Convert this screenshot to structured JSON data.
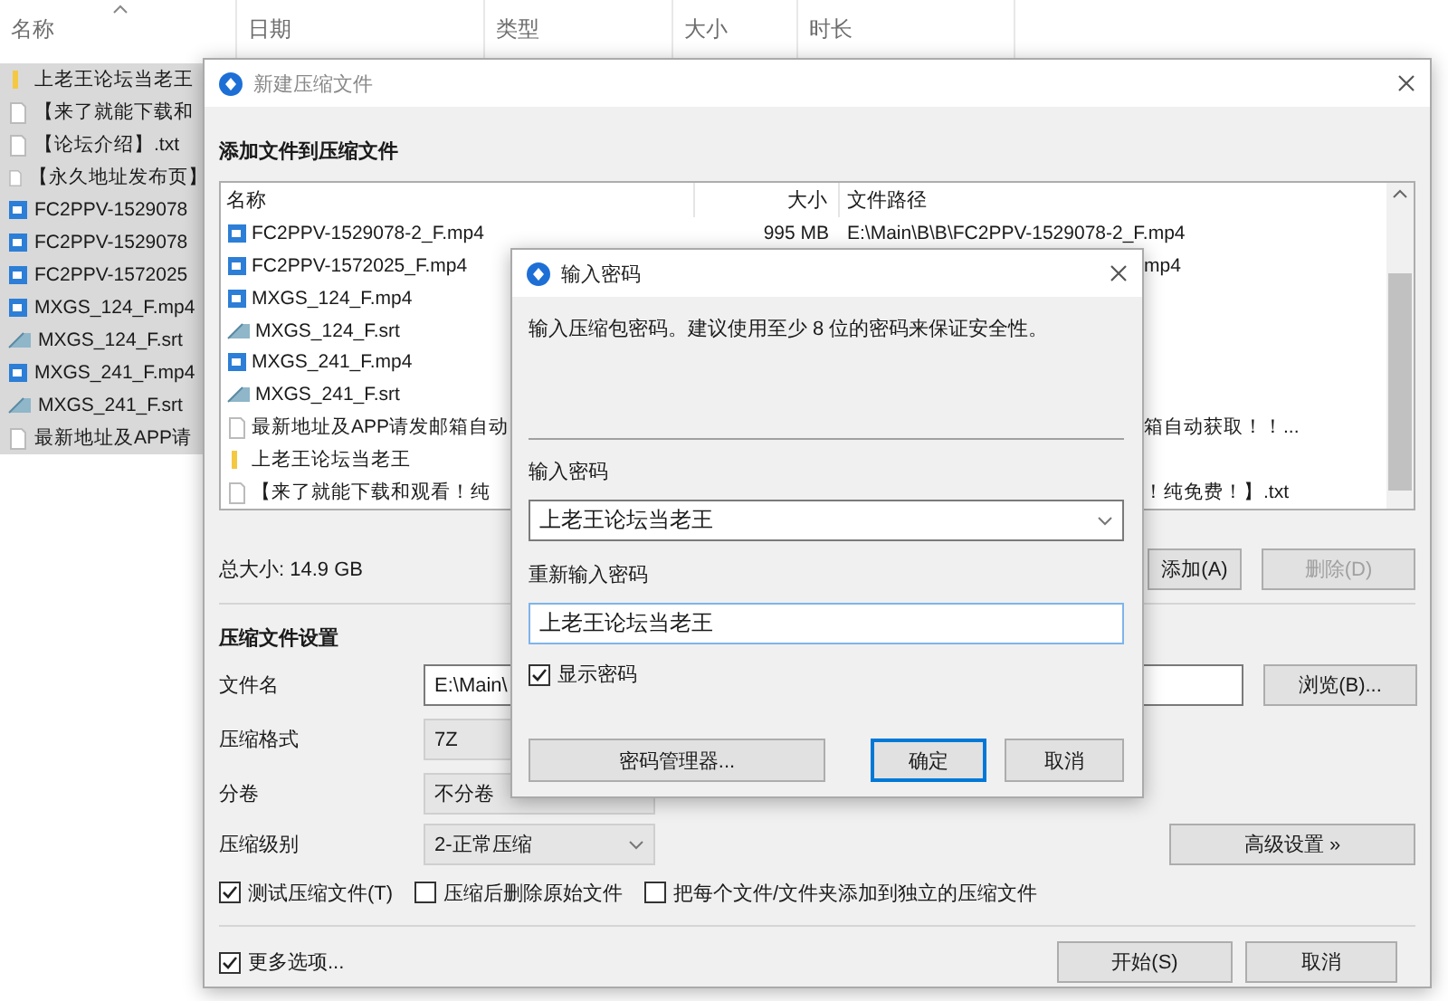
{
  "explorer": {
    "columns": [
      "名称",
      "日期",
      "类型",
      "大小",
      "时长"
    ],
    "items": [
      {
        "name": "上老王论坛当老王",
        "kind": "folder",
        "selected": true
      },
      {
        "name": "【来了就能下载和",
        "kind": "text",
        "selected": true
      },
      {
        "name": "【论坛介绍】.txt",
        "kind": "text",
        "selected": true
      },
      {
        "name": "【永久地址发布页】",
        "kind": "text",
        "selected": true
      },
      {
        "name": "FC2PPV-1529078",
        "kind": "video",
        "selected": true
      },
      {
        "name": "FC2PPV-1529078",
        "kind": "video",
        "selected": true
      },
      {
        "name": "FC2PPV-1572025",
        "kind": "video",
        "selected": true
      },
      {
        "name": "MXGS_124_F.mp4",
        "kind": "video",
        "selected": true
      },
      {
        "name": "MXGS_124_F.srt",
        "kind": "subtitle",
        "selected": true
      },
      {
        "name": "MXGS_241_F.mp4",
        "kind": "video",
        "selected": true
      },
      {
        "name": "MXGS_241_F.srt",
        "kind": "subtitle",
        "selected": true
      },
      {
        "name": "最新地址及APP请",
        "kind": "text",
        "selected": true
      }
    ]
  },
  "archive_window": {
    "title": "新建压缩文件",
    "section_title": "添加文件到压缩文件",
    "file_list": {
      "columns": [
        "名称",
        "大小",
        "文件路径"
      ],
      "rows": [
        {
          "name": "FC2PPV-1529078-2_F.mp4",
          "kind": "video",
          "size": "995 MB",
          "path": "E:\\Main\\B\\B\\FC2PPV-1529078-2_F.mp4"
        },
        {
          "name": "FC2PPV-1572025_F.mp4",
          "kind": "video",
          "path_tail": "mp4"
        },
        {
          "name": "MXGS_124_F.mp4",
          "kind": "video"
        },
        {
          "name": "MXGS_124_F.srt",
          "kind": "subtitle"
        },
        {
          "name": "MXGS_241_F.mp4",
          "kind": "video"
        },
        {
          "name": "MXGS_241_F.srt",
          "kind": "subtitle"
        },
        {
          "name": "最新地址及APP请发邮箱自动",
          "kind": "text",
          "path_tail": "箱自动获取！！..."
        },
        {
          "name": "上老王论坛当老王",
          "kind": "folder"
        },
        {
          "name": "【来了就能下载和观看！纯",
          "kind": "text",
          "path_tail": "！纯免费！】.txt"
        }
      ]
    },
    "total_size": "总大小: 14.9 GB",
    "add_button": {
      "label": "添加(A)",
      "disabled": false
    },
    "remove_button": {
      "label": "删除(D)",
      "disabled": true
    },
    "settings_title": "压缩文件设置",
    "filename": {
      "label": "文件名",
      "value": "E:\\Main\\",
      "browse": "浏览(B)..."
    },
    "format": {
      "label": "压缩格式",
      "value": "7Z"
    },
    "split": {
      "label": "分卷",
      "value": "不分卷"
    },
    "level": {
      "label": "压缩级别",
      "value": "2-正常压缩",
      "advanced": "高级设置 »"
    },
    "options": [
      {
        "label": "测试压缩文件(T)",
        "checked": true
      },
      {
        "label": "压缩后删除原始文件",
        "checked": false
      },
      {
        "label": "把每个文件/文件夹添加到独立的压缩文件",
        "checked": false
      }
    ],
    "more_options": {
      "label": "更多选项...",
      "checked": true
    },
    "start_button": "开始(S)",
    "cancel_button": "取消"
  },
  "password_dialog": {
    "title": "输入密码",
    "hint": "输入压缩包密码。建议使用至少 8 位的密码来保证安全性。",
    "password_label": "输入密码",
    "password_value": "上老王论坛当老王",
    "confirm_label": "重新输入密码",
    "confirm_value": "上老王论坛当老王",
    "show_password": {
      "label": "显示密码",
      "checked": true
    },
    "manager_button": "密码管理器...",
    "ok_button": "确定",
    "cancel_button": "取消"
  }
}
